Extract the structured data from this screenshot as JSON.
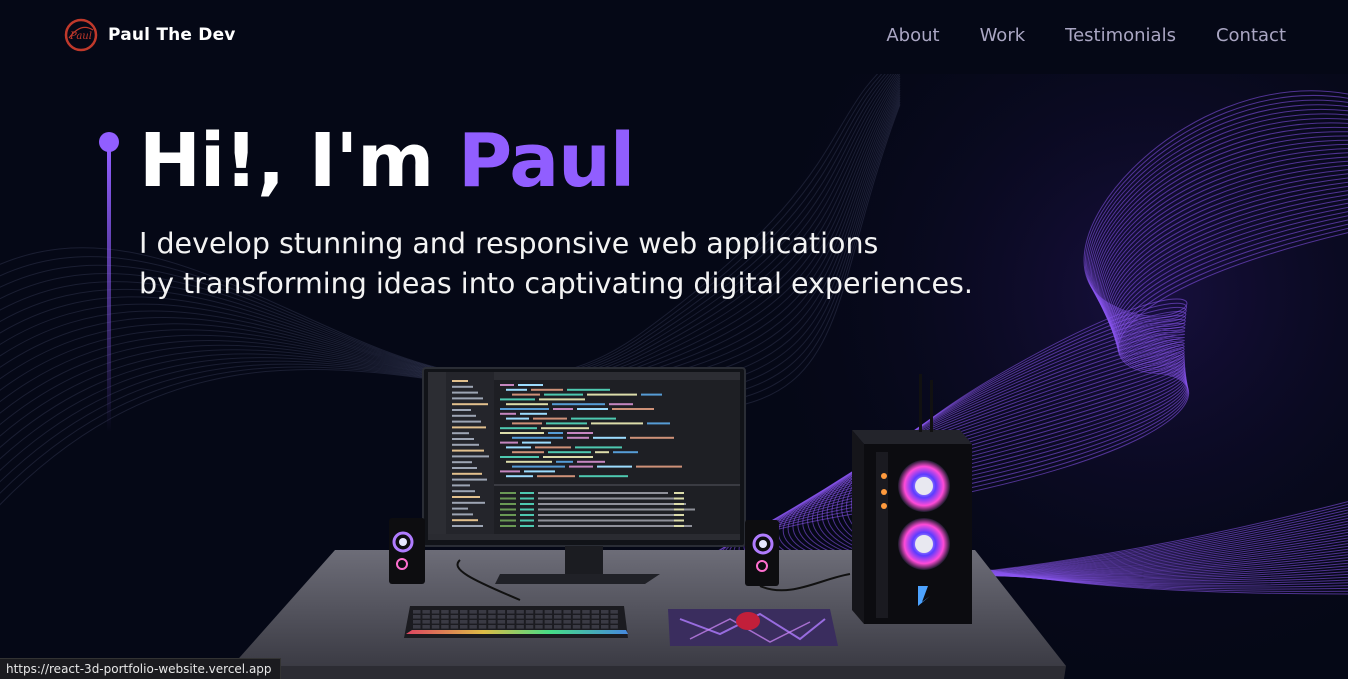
{
  "brand": {
    "name": "Paul The Dev",
    "logo_text": "Paul",
    "logo_color": "#c0392b"
  },
  "nav": {
    "items": [
      "About",
      "Work",
      "Testimonials",
      "Contact"
    ]
  },
  "hero": {
    "greeting": "Hi!, I'm",
    "name": "Paul",
    "subtitle_line1": "I develop stunning and responsive web applications",
    "subtitle_line2": "by transforming ideas into captivating digital experiences.",
    "accent_color": "#915eff"
  },
  "status_bar": {
    "url": "https://react-3d-portfolio-website.vercel.app"
  },
  "colors": {
    "background": "#050816",
    "nav_text": "#aaa6c3",
    "primary_text": "#ffffff"
  }
}
